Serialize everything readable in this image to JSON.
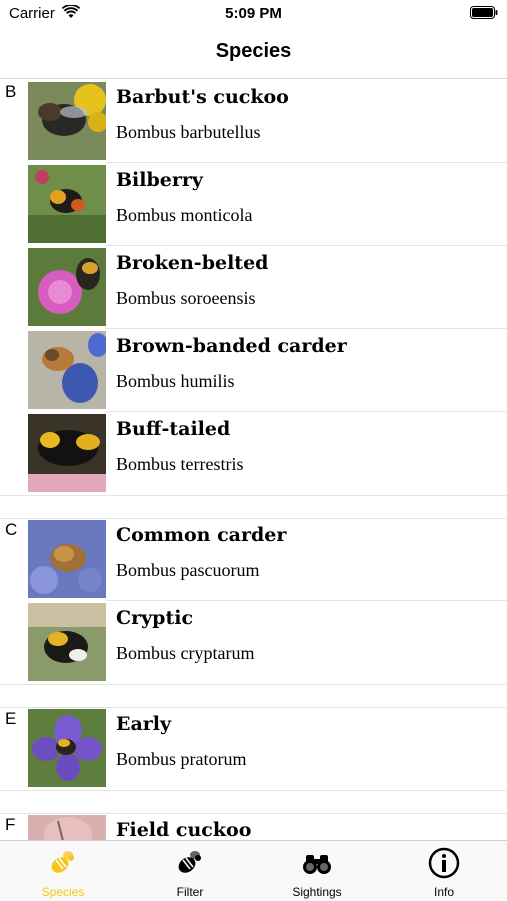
{
  "status_bar": {
    "carrier": "Carrier",
    "time": "5:09 PM"
  },
  "nav": {
    "title": "Species"
  },
  "sections": [
    {
      "letter": "B",
      "items": [
        {
          "common": "Barbut's cuckoo",
          "latin": "Bombus barbutellus"
        },
        {
          "common": "Bilberry",
          "latin": "Bombus monticola"
        },
        {
          "common": "Broken-belted",
          "latin": "Bombus soroeensis"
        },
        {
          "common": "Brown-banded carder",
          "latin": "Bombus humilis"
        },
        {
          "common": "Buff-tailed",
          "latin": "Bombus terrestris"
        }
      ]
    },
    {
      "letter": "C",
      "items": [
        {
          "common": "Common carder",
          "latin": "Bombus pascuorum"
        },
        {
          "common": "Cryptic",
          "latin": "Bombus cryptarum"
        }
      ]
    },
    {
      "letter": "E",
      "items": [
        {
          "common": "Early",
          "latin": "Bombus pratorum"
        }
      ]
    },
    {
      "letter": "F",
      "items": [
        {
          "common": "Field cuckoo",
          "latin": ""
        }
      ]
    }
  ],
  "tabs": [
    {
      "label": "Species",
      "icon": "bee-icon",
      "active": true
    },
    {
      "label": "Filter",
      "icon": "bee-filter-icon",
      "active": false
    },
    {
      "label": "Sightings",
      "icon": "binoculars-icon",
      "active": false
    },
    {
      "label": "Info",
      "icon": "info-icon",
      "active": false
    }
  ],
  "colors": {
    "accent": "#f5c518",
    "separator": "#e4e4e4"
  }
}
